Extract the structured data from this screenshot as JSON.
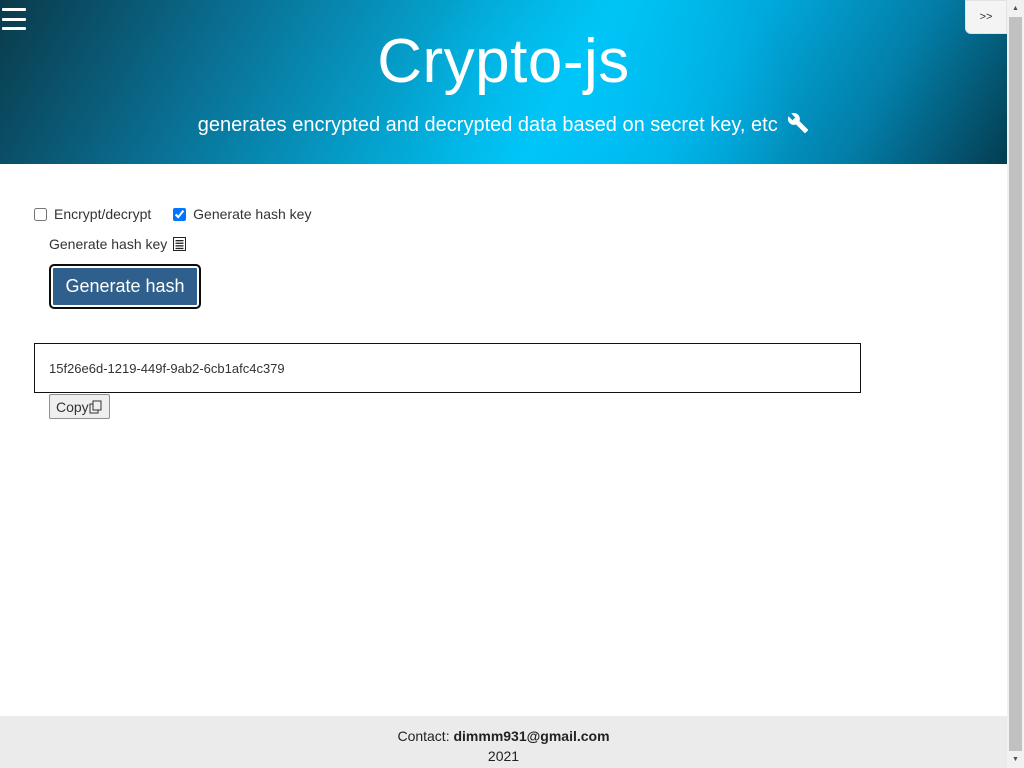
{
  "header": {
    "title": "Crypto-js",
    "subtitle": "generates encrypted and decrypted data based on secret key, etc",
    "collapse_label": ">>",
    "menu_icon": "hamburger-menu-icon",
    "subtitle_icon": "wrench-icon"
  },
  "options": {
    "encrypt_label": "Encrypt/decrypt",
    "encrypt_checked": false,
    "hash_label": "Generate hash key",
    "hash_checked": true
  },
  "hash_section": {
    "label": "Generate hash key",
    "label_icon": "document-icon",
    "button_label": "Generate hash",
    "result_value": "15f26e6d-1219-449f-9ab2-6cb1afc4c379",
    "copy_label": "Copy",
    "copy_icon": "copy-icon"
  },
  "footer": {
    "contact_label": "Contact:",
    "email": "dimmm931@gmail.com",
    "year": "2021"
  },
  "colors": {
    "header_gradient_center": "#00c4f4",
    "header_gradient_edge": "#0a3a4a",
    "primary_button": "#2f5f8d",
    "footer_background": "#ebebeb"
  }
}
